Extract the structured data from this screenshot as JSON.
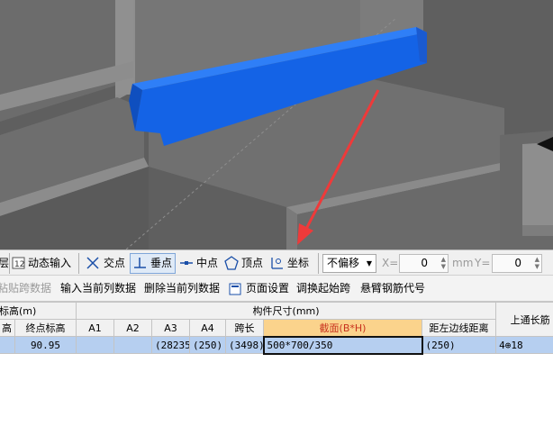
{
  "toolbar_snap": {
    "cut_label": "层",
    "dynamic_input": "动态输入",
    "intersection": "交点",
    "perpendicular": "垂点",
    "midpoint": "中点",
    "vertex": "顶点",
    "coordinate": "坐标",
    "offset_mode": "不偏移",
    "x_label": "X=",
    "x_value": "0",
    "x_unit": "mm",
    "y_label": "Y=",
    "y_value": "0"
  },
  "toolbar_span": {
    "paste_span": "粘贴跨数据",
    "input_column": "输入当前列数据",
    "delete_column": "删除当前列数据",
    "page_setup": "页面设置",
    "adjust_start_span": "调换起始跨",
    "cantilever_code": "悬臂钢筋代号"
  },
  "table": {
    "group_elevation": "标高(m)",
    "group_size": "构件尺寸(mm)",
    "headers": {
      "start_elev": "高",
      "end_elev": "终点标高",
      "a1": "A1",
      "a2": "A2",
      "a3": "A3",
      "a4": "A4",
      "span_length": "跨长",
      "section": "截面(B*H)",
      "left_edge_distance": "距左边线距离",
      "top_through_bar": "上通长筋"
    },
    "row": {
      "start_elev": "",
      "end_elev": "90.95",
      "a1": "",
      "a2": "",
      "a3": "(28235",
      "a4": "(250)",
      "span_length": "(3498)",
      "section": "500*700/350",
      "left_edge_distance": "(250)",
      "top_through_bar": "4⊕18"
    }
  },
  "colors": {
    "beam": "#1463e6",
    "arrow": "#ee3a3a",
    "header_highlight": "#fbd38c",
    "selected_row": "#b6cff0"
  }
}
